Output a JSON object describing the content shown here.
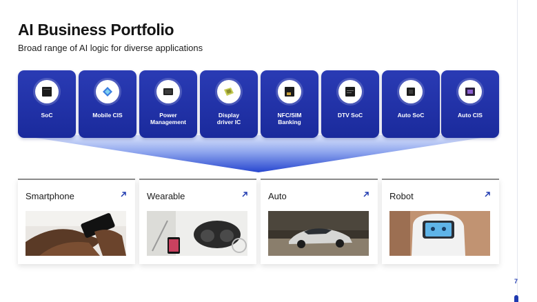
{
  "header": {
    "title": "AI Business Portfolio",
    "subtitle": "Broad range of AI logic for diverse applications"
  },
  "products": [
    {
      "label": "SoC",
      "icon": "chip-icon"
    },
    {
      "label": "Mobile CIS",
      "icon": "image-sensor-icon"
    },
    {
      "label": "Power\nManagement",
      "icon": "power-chip-icon"
    },
    {
      "label": "Display\ndriver IC",
      "icon": "display-driver-icon"
    },
    {
      "label": "NFC/SIM\nBanking",
      "icon": "nfc-chip-icon"
    },
    {
      "label": "DTV SoC",
      "icon": "dtv-chip-icon"
    },
    {
      "label": "Auto SoC",
      "icon": "auto-chip-icon"
    },
    {
      "label": "Auto CIS",
      "icon": "auto-sensor-icon"
    }
  ],
  "applications": [
    {
      "label": "Smartphone",
      "image": "smartphone-photo"
    },
    {
      "label": "Wearable",
      "image": "wearable-photo"
    },
    {
      "label": "Auto",
      "image": "auto-photo"
    },
    {
      "label": "Robot",
      "image": "robot-photo"
    }
  ],
  "footer": {
    "page_number": "7"
  },
  "colors": {
    "chip_blue": "#1f2fa6",
    "funnel_blue": "#2e4fd6",
    "accent": "#1f3ab0"
  }
}
